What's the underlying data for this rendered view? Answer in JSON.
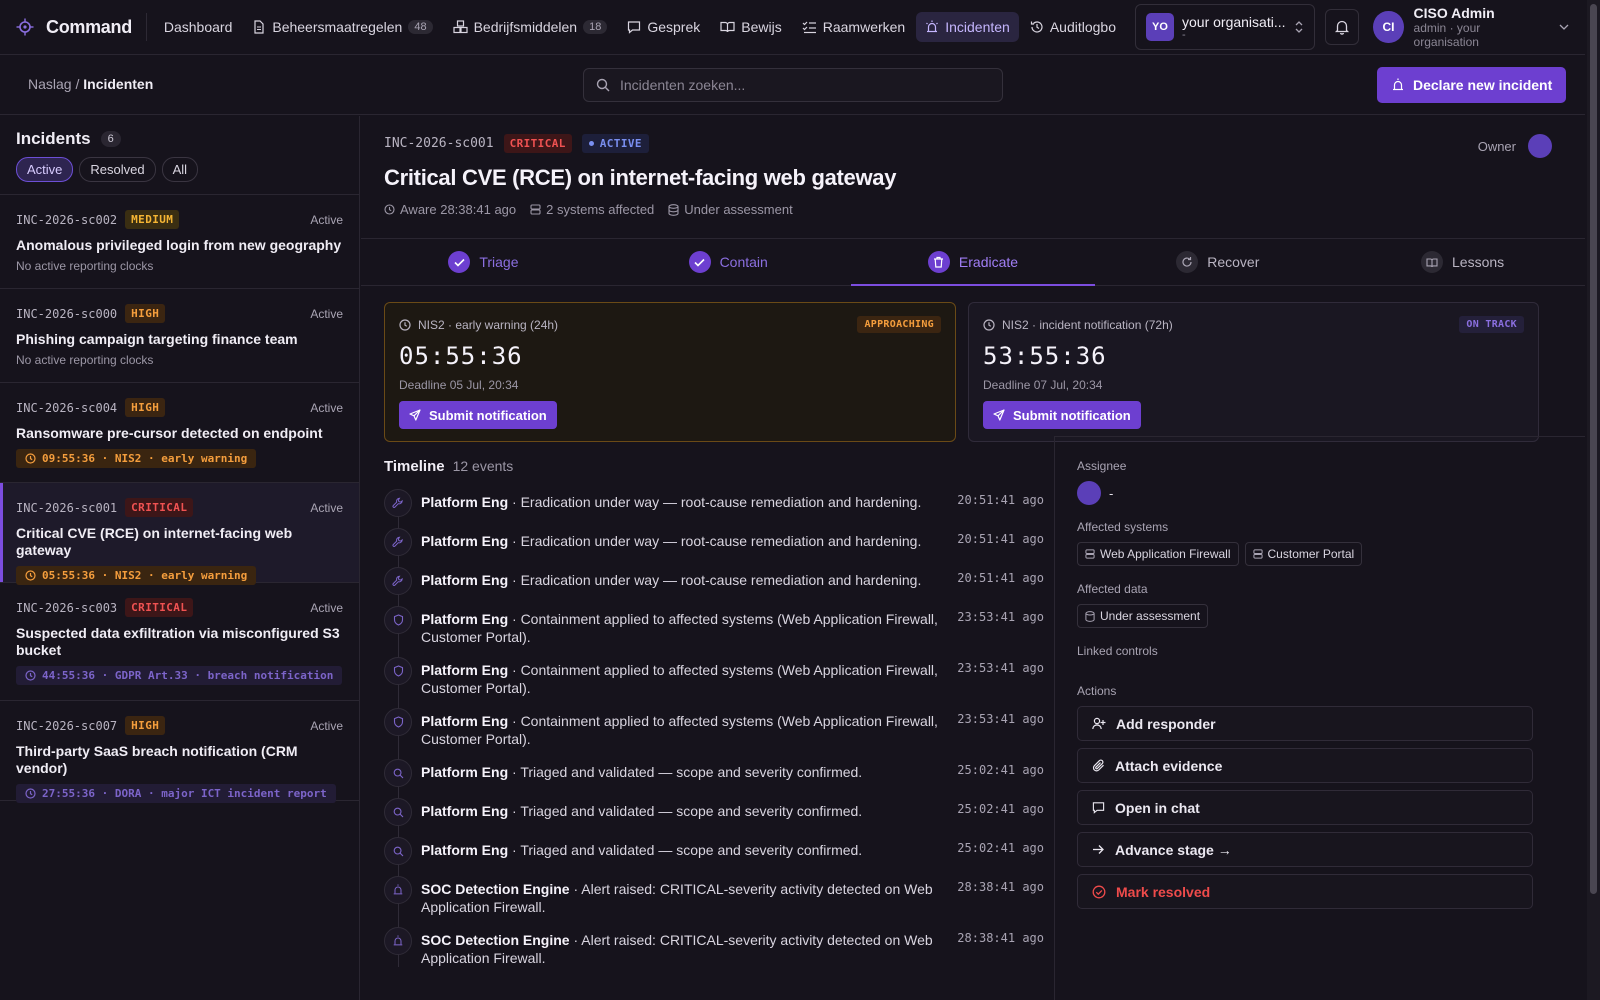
{
  "nav": {
    "brand": "Command",
    "items": [
      {
        "label": "Dashboard",
        "badge": ""
      },
      {
        "label": "Beheersmaatregelen",
        "badge": "48"
      },
      {
        "label": "Bedrijfsmiddelen",
        "badge": "18"
      },
      {
        "label": "Gesprek",
        "badge": ""
      },
      {
        "label": "Bewijs",
        "badge": ""
      },
      {
        "label": "Raamwerken",
        "badge": ""
      },
      {
        "label": "Incidenten",
        "badge": ""
      },
      {
        "label": "Auditlogbo",
        "badge": ""
      }
    ],
    "org": {
      "initials": "YO",
      "name": "your organisati...",
      "sub": "-"
    },
    "user": {
      "initials": "CI",
      "name": "CISO Admin",
      "role": "admin · your organisation"
    }
  },
  "subheader": {
    "breadcrumb_parent": "Naslag",
    "breadcrumb_sep": "/",
    "breadcrumb_current": "Incidenten",
    "search_placeholder": "Incidenten zoeken...",
    "declare_label": "Declare new incident"
  },
  "sidebar": {
    "title": "Incidents",
    "count": "6",
    "filters": [
      "Active",
      "Resolved",
      "All"
    ],
    "incidents": [
      {
        "id": "INC-2026-sc002",
        "severity": "MEDIUM",
        "status": "Active",
        "title": "Anomalous privileged login from new geography",
        "sub": "No active reporting clocks",
        "clock": ""
      },
      {
        "id": "INC-2026-sc000",
        "severity": "HIGH",
        "status": "Active",
        "title": "Phishing campaign targeting finance team",
        "sub": "No active reporting clocks",
        "clock": ""
      },
      {
        "id": "INC-2026-sc004",
        "severity": "HIGH",
        "status": "Active",
        "title": "Ransomware pre-cursor detected on endpoint",
        "sub": "",
        "clock": "09:55:36 · NIS2 · early warning"
      },
      {
        "id": "INC-2026-sc001",
        "severity": "CRITICAL",
        "status": "Active",
        "title": "Critical CVE (RCE) on internet-facing web gateway",
        "sub": "",
        "clock": "05:55:36 · NIS2 · early warning"
      },
      {
        "id": "INC-2026-sc003",
        "severity": "CRITICAL",
        "status": "Active",
        "title": "Suspected data exfiltration via misconfigured S3 bucket",
        "sub": "",
        "clock": "44:55:36 · GDPR Art.33 · breach notification"
      },
      {
        "id": "INC-2026-sc007",
        "severity": "HIGH",
        "status": "Active",
        "title": "Third-party SaaS breach notification (CRM vendor)",
        "sub": "",
        "clock": "27:55:36 · DORA · major ICT incident report"
      }
    ]
  },
  "detail": {
    "id": "INC-2026-sc001",
    "severity": "CRITICAL",
    "status": "ACTIVE",
    "title": "Critical CVE (RCE) on internet-facing web gateway",
    "aware": "Aware 28:38:41 ago",
    "systems": "2 systems affected",
    "assessment": "Under assessment",
    "owner_label": "Owner",
    "stages": [
      "Triage",
      "Contain",
      "Eradicate",
      "Recover",
      "Lessons"
    ],
    "clocks": [
      {
        "label": "NIS2 · early warning (24h)",
        "pill": "APPROACHING",
        "time": "05:55:36",
        "deadline": "Deadline 05 Jul, 20:34",
        "button": "Submit notification"
      },
      {
        "label": "NIS2 · incident notification (72h)",
        "pill": "ON TRACK",
        "time": "53:55:36",
        "deadline": "Deadline 07 Jul, 20:34",
        "button": "Submit notification"
      }
    ],
    "timeline": {
      "title": "Timeline",
      "count": "12 events",
      "events": [
        {
          "actor": "Platform Eng",
          "text": " · Eradication under way — root-cause remediation and hardening.",
          "time": "20:51:41 ago",
          "icon": "wrench-icon"
        },
        {
          "actor": "Platform Eng",
          "text": " · Eradication under way — root-cause remediation and hardening.",
          "time": "20:51:41 ago",
          "icon": "wrench-icon"
        },
        {
          "actor": "Platform Eng",
          "text": " · Eradication under way — root-cause remediation and hardening.",
          "time": "20:51:41 ago",
          "icon": "wrench-icon"
        },
        {
          "actor": "Platform Eng",
          "text": " · Containment applied to affected systems (Web Application Firewall, Customer Portal).",
          "time": "23:53:41 ago",
          "icon": "shield-icon"
        },
        {
          "actor": "Platform Eng",
          "text": " · Containment applied to affected systems (Web Application Firewall, Customer Portal).",
          "time": "23:53:41 ago",
          "icon": "shield-icon"
        },
        {
          "actor": "Platform Eng",
          "text": " · Containment applied to affected systems (Web Application Firewall, Customer Portal).",
          "time": "23:53:41 ago",
          "icon": "shield-icon"
        },
        {
          "actor": "Platform Eng",
          "text": " · Triaged and validated — scope and severity confirmed.",
          "time": "25:02:41 ago",
          "icon": "search-icon"
        },
        {
          "actor": "Platform Eng",
          "text": " · Triaged and validated — scope and severity confirmed.",
          "time": "25:02:41 ago",
          "icon": "search-icon"
        },
        {
          "actor": "Platform Eng",
          "text": " · Triaged and validated — scope and severity confirmed.",
          "time": "25:02:41 ago",
          "icon": "search-icon"
        },
        {
          "actor": "SOC Detection Engine",
          "text": " · Alert raised: CRITICAL-severity activity detected on Web Application Firewall.",
          "time": "28:38:41 ago",
          "icon": "siren-icon"
        },
        {
          "actor": "SOC Detection Engine",
          "text": " · Alert raised: CRITICAL-severity activity detected on Web Application Firewall.",
          "time": "28:38:41 ago",
          "icon": "siren-icon"
        }
      ]
    },
    "panel": {
      "assignee_label": "Assignee",
      "assignee_value": "-",
      "systems_label": "Affected systems",
      "systems": [
        "Web Application Firewall",
        "Customer Portal"
      ],
      "data_label": "Affected data",
      "data": [
        "Under assessment"
      ],
      "controls_label": "Linked controls",
      "actions_label": "Actions",
      "actions": [
        "Add responder",
        "Attach evidence",
        "Open in chat",
        "Advance stage →",
        "Mark resolved"
      ]
    }
  },
  "colors": {
    "accent": "#6d3fd0",
    "critical": "#f05252",
    "high": "#f59e3d",
    "medium": "#f5b534"
  }
}
